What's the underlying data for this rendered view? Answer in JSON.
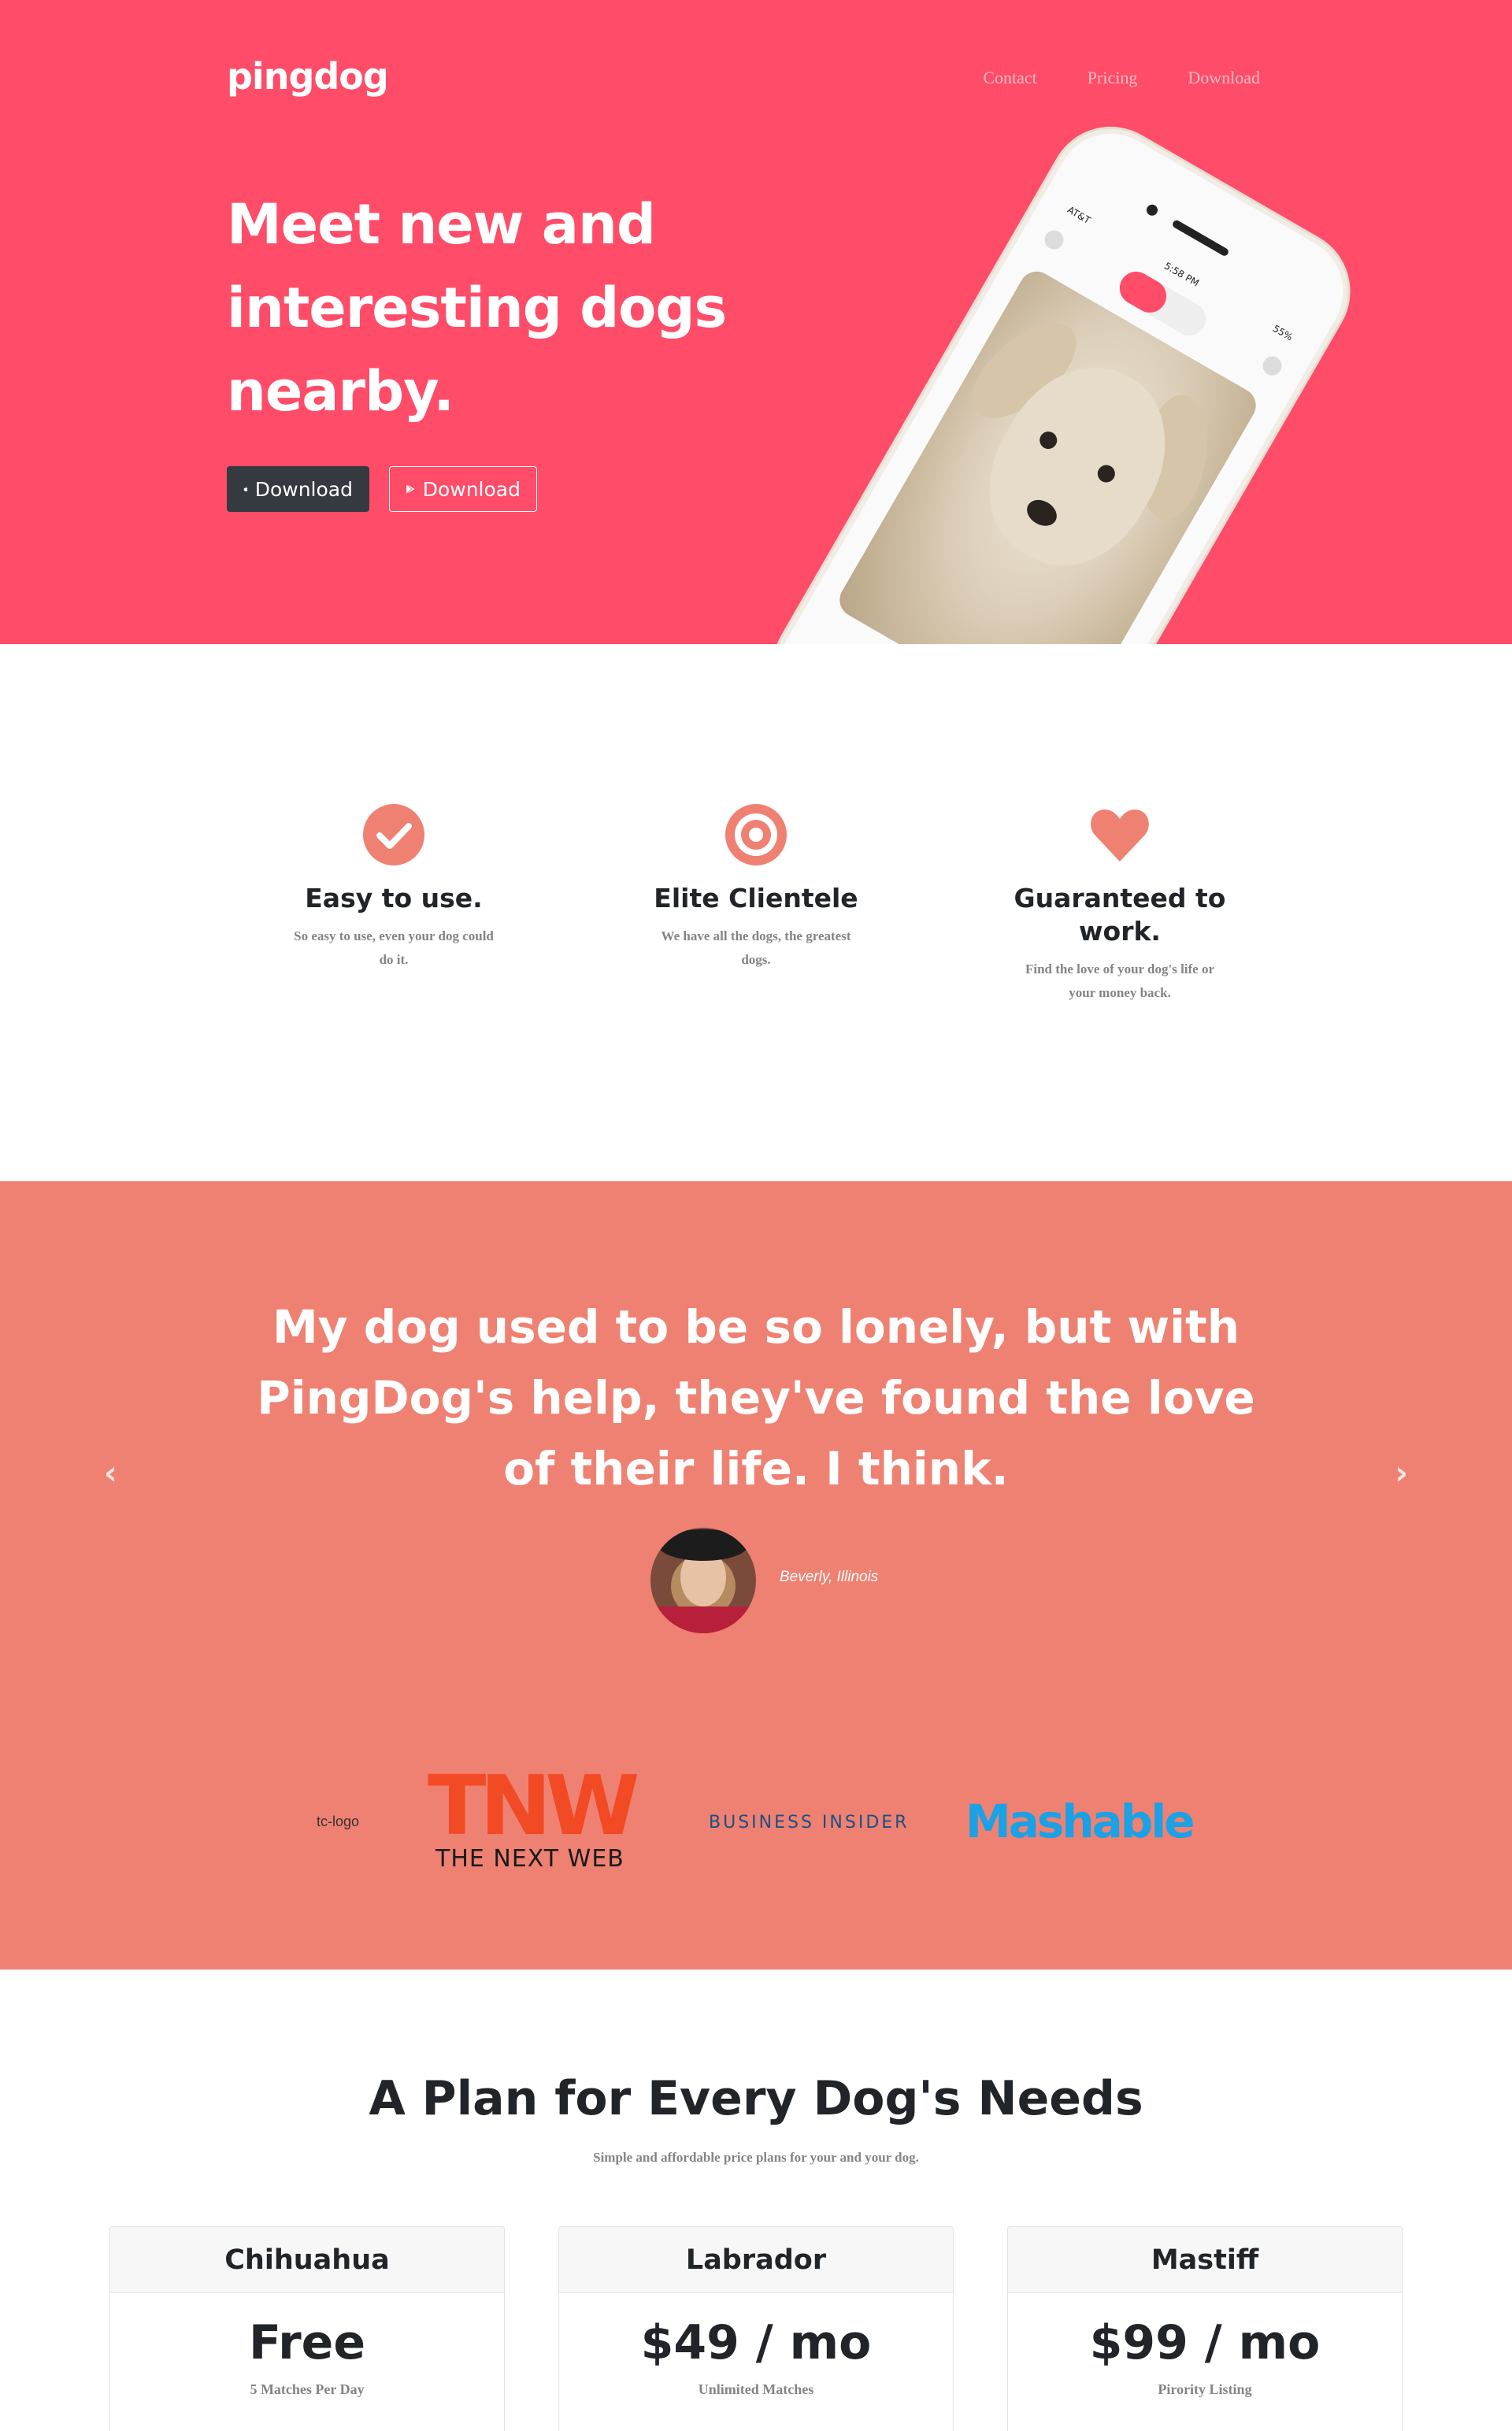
{
  "brand": "pingdog",
  "nav": {
    "contact": "Contact",
    "pricing": "Pricing",
    "download": "Download"
  },
  "hero": {
    "title": "Meet new and interesting dogs nearby.",
    "ios_button": "Download",
    "android_button": "Download",
    "phone": {
      "carrier": "AT&T",
      "time": "5:58 PM",
      "battery": "55%"
    }
  },
  "features": [
    {
      "icon": "check-circle-icon",
      "title": "Easy to use.",
      "text": "So easy to use, even your dog could do it."
    },
    {
      "icon": "target-icon",
      "title": "Elite Clientele",
      "text": "We have all the dogs, the greatest dogs."
    },
    {
      "icon": "heart-icon",
      "title": "Guaranteed to work.",
      "text": "Find the love of your dog's life or your money back."
    }
  ],
  "testimonial": {
    "quote": "My dog used to be so lonely, but with PingDog's help, they've found the love of their life. I think.",
    "location": "Beverly, Illinois"
  },
  "press": {
    "tc_alt": "tc-logo",
    "tnw_mark": "TNW",
    "tnw_name": "THE NEXT WEB",
    "business_insider": "BUSINESS INSIDER",
    "mashable": "Mashable"
  },
  "pricing": {
    "title": "A Plan for Every Dog's Needs",
    "subtitle": "Simple and affordable price plans for your and your dog.",
    "plans": [
      {
        "name": "Chihuahua",
        "price": "Free",
        "feature": "5 Matches Per Day"
      },
      {
        "name": "Labrador",
        "price": "$49 / mo",
        "feature": "Unlimited Matches"
      },
      {
        "name": "Mastiff",
        "price": "$99 / mo",
        "feature": "Pirority Listing"
      }
    ]
  },
  "colors": {
    "hero_bg": "#ff4c68",
    "testimonial_bg": "#ef8172",
    "accent_icon": "#ef8172"
  }
}
